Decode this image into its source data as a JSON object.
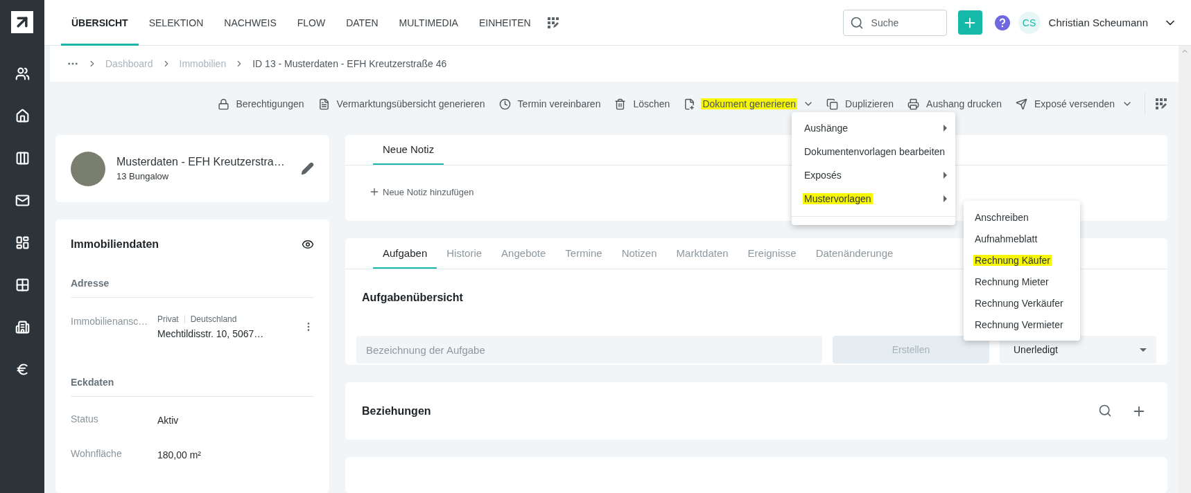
{
  "sidebar": {
    "items": [
      {
        "selected": false
      },
      {
        "selected": false
      },
      {
        "selected": false
      },
      {
        "selected": false
      },
      {
        "selected": false
      },
      {
        "selected": false
      },
      {
        "selected": false
      },
      {
        "selected": false
      }
    ]
  },
  "topnav": {
    "tabs": [
      {
        "label": "ÜBERSICHT",
        "selected": true
      },
      {
        "label": "SELEKTION",
        "selected": false
      },
      {
        "label": "NACHWEIS",
        "selected": false
      },
      {
        "label": "FLOW",
        "selected": false
      },
      {
        "label": "DATEN",
        "selected": false
      },
      {
        "label": "MULTIMEDIA",
        "selected": false
      },
      {
        "label": "EINHEITEN",
        "selected": false
      }
    ],
    "search": {
      "placeholder": "Suche"
    },
    "user": {
      "initials": "CS",
      "name": "Christian Scheumann"
    }
  },
  "breadcrumb": [
    {
      "label": "Dashboard",
      "current": false
    },
    {
      "label": "Immobilien",
      "current": false
    },
    {
      "label": "ID 13 - Musterdaten - EFH Kreutzerstraße 46",
      "current": true
    }
  ],
  "toolbar": [
    {
      "label": "Berechtigungen",
      "highlighted": false,
      "dropdown": false
    },
    {
      "label": "Vermarktungsübersicht generieren",
      "highlighted": false,
      "dropdown": false
    },
    {
      "label": "Termin vereinbaren",
      "highlighted": false,
      "dropdown": false
    },
    {
      "label": "Löschen",
      "highlighted": false,
      "dropdown": false
    },
    {
      "label": "Dokument generieren",
      "highlighted": true,
      "dropdown": true
    },
    {
      "label": "Duplizieren",
      "highlighted": false,
      "dropdown": false
    },
    {
      "label": "Aushang drucken",
      "highlighted": false,
      "dropdown": false
    },
    {
      "label": "Exposé versenden",
      "highlighted": false,
      "dropdown": true
    }
  ],
  "menu": [
    {
      "label": "Aushänge",
      "submenu": true,
      "highlighted": false
    },
    {
      "label": "Dokumentenvorlagen bearbeiten",
      "submenu": false,
      "highlighted": false
    },
    {
      "label": "Exposés",
      "submenu": true,
      "highlighted": false
    },
    {
      "label": "Mustervorlagen",
      "submenu": true,
      "highlighted": true
    }
  ],
  "submenu": [
    {
      "label": "Anschreiben",
      "highlighted": false
    },
    {
      "label": "Aufnahmeblatt",
      "highlighted": false
    },
    {
      "label": "Rechnung Käufer",
      "highlighted": true
    },
    {
      "label": "Rechnung Mieter",
      "highlighted": false
    },
    {
      "label": "Rechnung Verkäufer",
      "highlighted": false
    },
    {
      "label": "Rechnung Vermieter",
      "highlighted": false
    }
  ],
  "property": {
    "title": "Musterdaten - EFH Kreutzerstra…",
    "subtitle": "13 Bungalow"
  },
  "property_data": {
    "title": "Immobiliendaten",
    "sections": [
      {
        "heading": "Adresse",
        "rows": [
          {
            "kind": "address",
            "label": "Immobilienansc…",
            "tags": [
              "Privat",
              "Deutschland"
            ],
            "value": "Mechtildisstr. 10, 5067…"
          }
        ]
      },
      {
        "heading": "Eckdaten",
        "rows": [
          {
            "kind": "plain",
            "label": "Status",
            "value": "Aktiv"
          },
          {
            "kind": "plain",
            "label": "Wohnfläche",
            "value": "180,00 m²"
          }
        ]
      }
    ]
  },
  "notes": {
    "tabs": [
      {
        "label": "Neue Notiz",
        "selected": true
      }
    ],
    "add_label": "Neue Notiz hinzufügen"
  },
  "tasks": {
    "tabs": [
      {
        "label": "Aufgaben",
        "selected": true
      },
      {
        "label": "Historie",
        "selected": false
      },
      {
        "label": "Angebote",
        "selected": false
      },
      {
        "label": "Termine",
        "selected": false
      },
      {
        "label": "Notizen",
        "selected": false
      },
      {
        "label": "Marktdaten",
        "selected": false
      },
      {
        "label": "Ereignisse",
        "selected": false
      },
      {
        "label": "Datenänderunge",
        "selected": false
      }
    ],
    "title": "Aufgabenübersicht",
    "input_placeholder": "Bezeichnung der Aufgabe",
    "create_button": {
      "label": "Erstellen",
      "disabled": true
    },
    "status_select": "Unerledigt"
  },
  "relations": {
    "title": "Beziehungen"
  }
}
